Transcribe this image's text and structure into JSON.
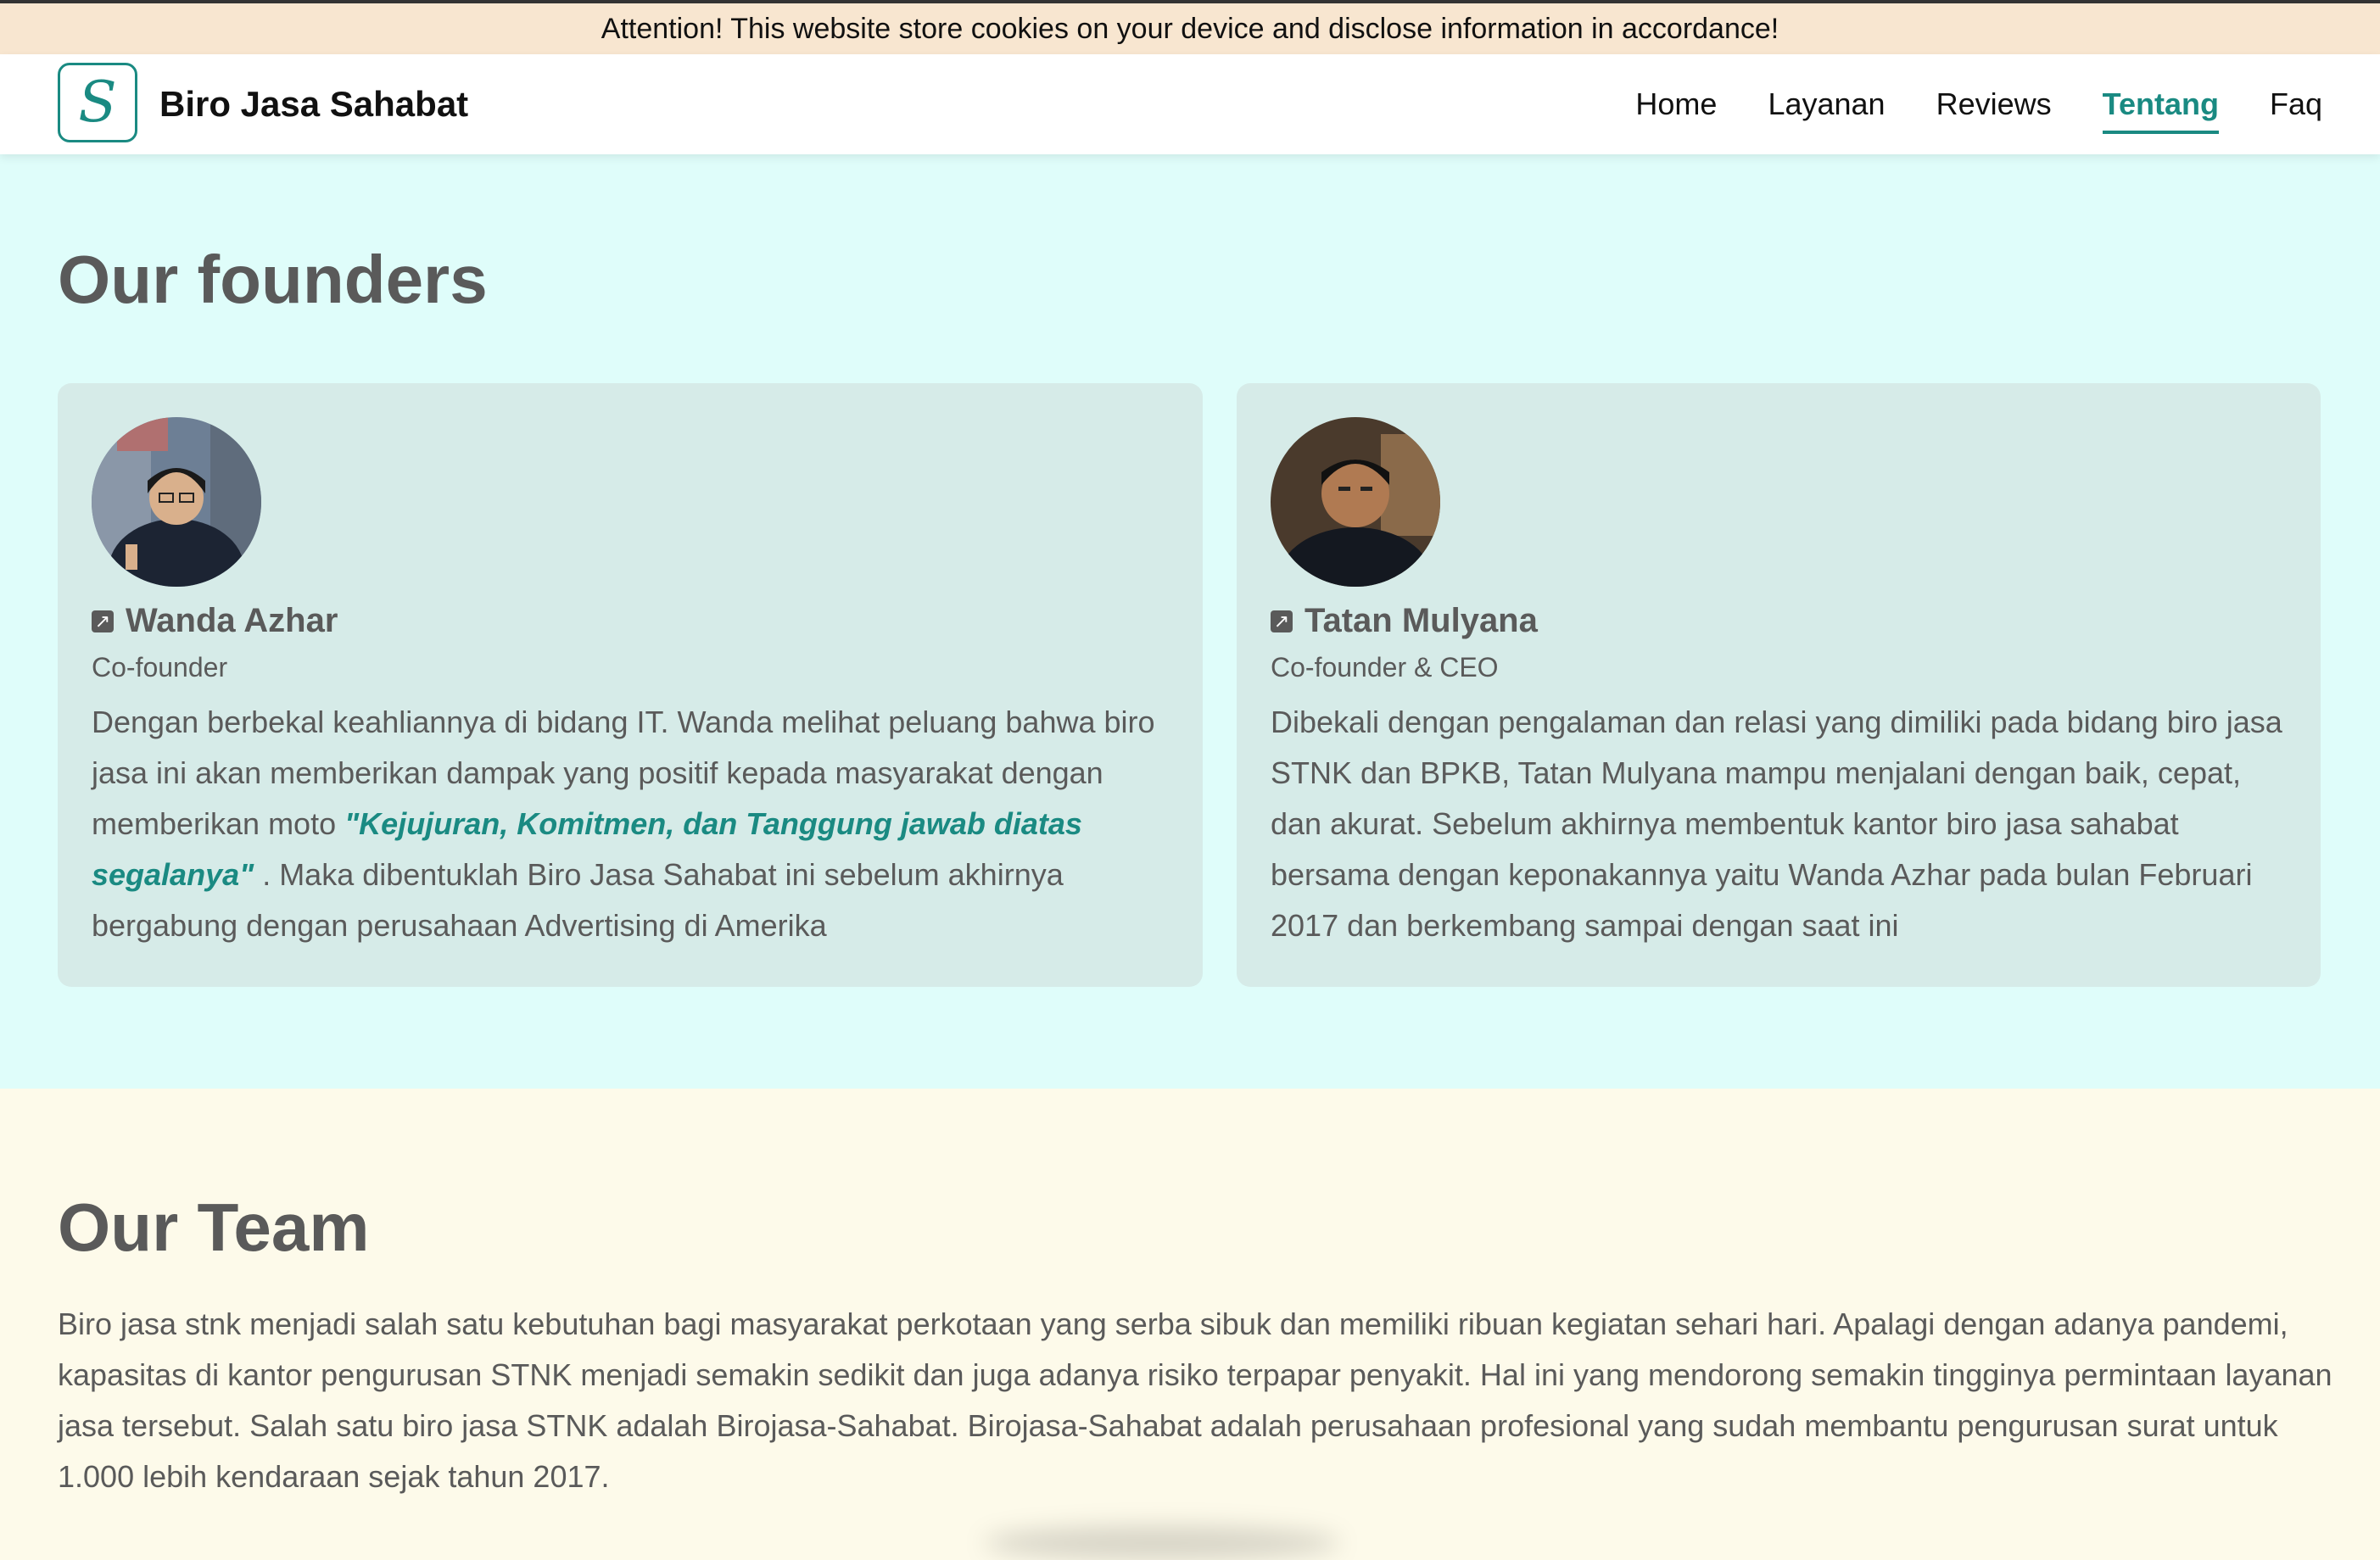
{
  "cookie_notice": "Attention! This website store cookies on your device and disclose information in accordance!",
  "brand": {
    "logo_letter": "S",
    "name": "Biro Jasa Sahabat",
    "accent_color": "#1a8a82"
  },
  "nav": {
    "items": [
      {
        "label": "Home",
        "active": false
      },
      {
        "label": "Layanan",
        "active": false
      },
      {
        "label": "Reviews",
        "active": false
      },
      {
        "label": "Tentang",
        "active": true
      },
      {
        "label": "Faq",
        "active": false
      }
    ]
  },
  "founders": {
    "title": "Our founders",
    "people": [
      {
        "name": "Wanda Azhar",
        "role": "Co-founder",
        "bio_part1": "Dengan berbekal keahliannya di bidang IT. Wanda melihat peluang bahwa biro jasa ini akan memberikan dampak yang positif kepada masyarakat dengan memberikan moto ",
        "motto": "\"Kejujuran, Komitmen, dan Tanggung jawab diatas segalanya\"",
        "bio_part2": " . Maka dibentuklah Biro Jasa Sahabat ini sebelum akhirnya bergabung dengan perusahaan Advertising di Amerika"
      },
      {
        "name": "Tatan Mulyana",
        "role": "Co-founder & CEO",
        "bio": "Dibekali dengan pengalaman dan relasi yang dimiliki pada bidang biro jasa STNK dan BPKB, Tatan Mulyana mampu menjalani dengan baik, cepat, dan akurat. Sebelum akhirnya membentuk kantor biro jasa sahabat bersama dengan keponakannya yaitu Wanda Azhar pada bulan Februari 2017 dan berkembang sampai dengan saat ini"
      }
    ]
  },
  "team": {
    "title": "Our Team",
    "text": "Biro jasa stnk menjadi salah satu kebutuhan bagi masyarakat perkotaan yang serba sibuk dan memiliki ribuan kegiatan sehari hari. Apalagi dengan adanya pandemi, kapasitas di kantor pengurusan STNK menjadi semakin sedikit dan juga adanya risiko terpapar penyakit. Hal ini yang mendorong semakin tingginya permintaan layanan jasa tersebut. Salah satu biro jasa STNK adalah Birojasa-Sahabat. Birojasa-Sahabat adalah perusahaan profesional yang sudah membantu pengurusan surat untuk 1.000 lebih kendaraan sejak tahun 2017."
  }
}
